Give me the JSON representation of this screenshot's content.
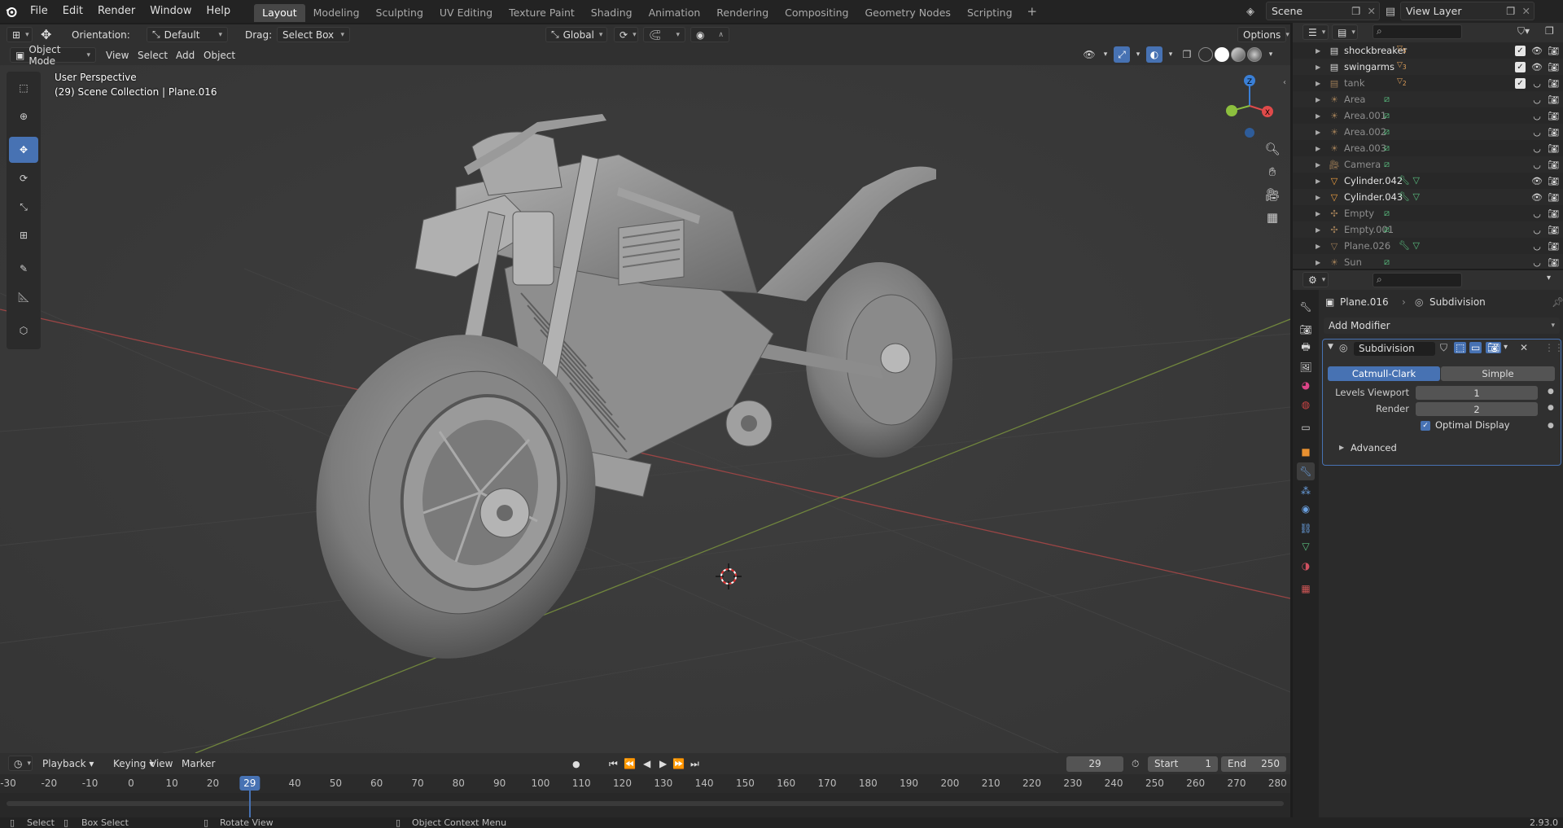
{
  "topbar": {
    "menus": [
      "File",
      "Edit",
      "Render",
      "Window",
      "Help"
    ],
    "workspaces": [
      "Layout",
      "Modeling",
      "Sculpting",
      "UV Editing",
      "Texture Paint",
      "Shading",
      "Animation",
      "Rendering",
      "Compositing",
      "Geometry Nodes",
      "Scripting"
    ],
    "active_workspace": "Layout",
    "scene": "Scene",
    "view_layer": "View Layer"
  },
  "viewport": {
    "orientation_label": "Orientation:",
    "orientation_value": "Default",
    "drag_label": "Drag:",
    "drag_value": "Select Box",
    "transform_orientation": "Global",
    "options": "Options",
    "mode": "Object Mode",
    "menus": [
      "View",
      "Select",
      "Add",
      "Object"
    ],
    "perspective": "User Perspective",
    "collection_info": "(29) Scene Collection | Plane.016",
    "gizmo": {
      "x": "X",
      "y": "Y",
      "z": "Z"
    }
  },
  "timeline": {
    "menus": [
      "Playback",
      "Keying",
      "View",
      "Marker"
    ],
    "current_frame": "29",
    "start_label": "Start",
    "start": "1",
    "end_label": "End",
    "end": "250",
    "ruler": [
      "-30",
      "-20",
      "-10",
      "0",
      "10",
      "20",
      "29",
      "40",
      "50",
      "60",
      "70",
      "80",
      "90",
      "100",
      "110",
      "120",
      "130",
      "140",
      "150",
      "160",
      "170",
      "180",
      "190",
      "200",
      "210",
      "220",
      "230",
      "240",
      "250",
      "260",
      "270",
      "280"
    ]
  },
  "statusbar": {
    "select": "Select",
    "box_select": "Box Select",
    "rotate_view": "Rotate View",
    "context_menu": "Object Context Menu",
    "version": "2.93.0"
  },
  "outliner": {
    "rows": [
      {
        "name": "shockbreaker",
        "type": "collection",
        "badge": "5",
        "checked": true,
        "dim": false
      },
      {
        "name": "swingarms",
        "type": "collection",
        "badge": "3",
        "checked": true,
        "dim": false
      },
      {
        "name": "tank",
        "type": "collection",
        "badge": "2",
        "checked": true,
        "dim": true
      },
      {
        "name": "Area",
        "type": "light",
        "dim": true
      },
      {
        "name": "Area.001",
        "type": "light",
        "dim": true
      },
      {
        "name": "Area.002",
        "type": "light",
        "dim": true
      },
      {
        "name": "Area.003",
        "type": "light",
        "dim": true
      },
      {
        "name": "Camera",
        "type": "camera",
        "dim": true
      },
      {
        "name": "Cylinder.042",
        "type": "mesh",
        "dim": false
      },
      {
        "name": "Cylinder.043",
        "type": "mesh",
        "dim": false
      },
      {
        "name": "Empty",
        "type": "empty",
        "dim": true
      },
      {
        "name": "Empty.001",
        "type": "empty",
        "dim": true
      },
      {
        "name": "Plane.026",
        "type": "mesh",
        "dim": true
      },
      {
        "name": "Sun",
        "type": "light",
        "dim": true
      }
    ]
  },
  "properties": {
    "object": "Plane.016",
    "modifier_crumb": "Subdivision",
    "add_modifier": "Add Modifier",
    "modifier": {
      "name": "Subdivision",
      "catmull": "Catmull-Clark",
      "simple": "Simple",
      "levels_label": "Levels Viewport",
      "levels_value": "1",
      "render_label": "Render",
      "render_value": "2",
      "optimal_display": "Optimal Display",
      "advanced": "Advanced"
    }
  },
  "colors": {
    "accent": "#4772b3",
    "background": "#393939",
    "x_axis": "#e04a4a",
    "y_axis": "#8cbf3e",
    "z_axis": "#3a7fd6"
  }
}
